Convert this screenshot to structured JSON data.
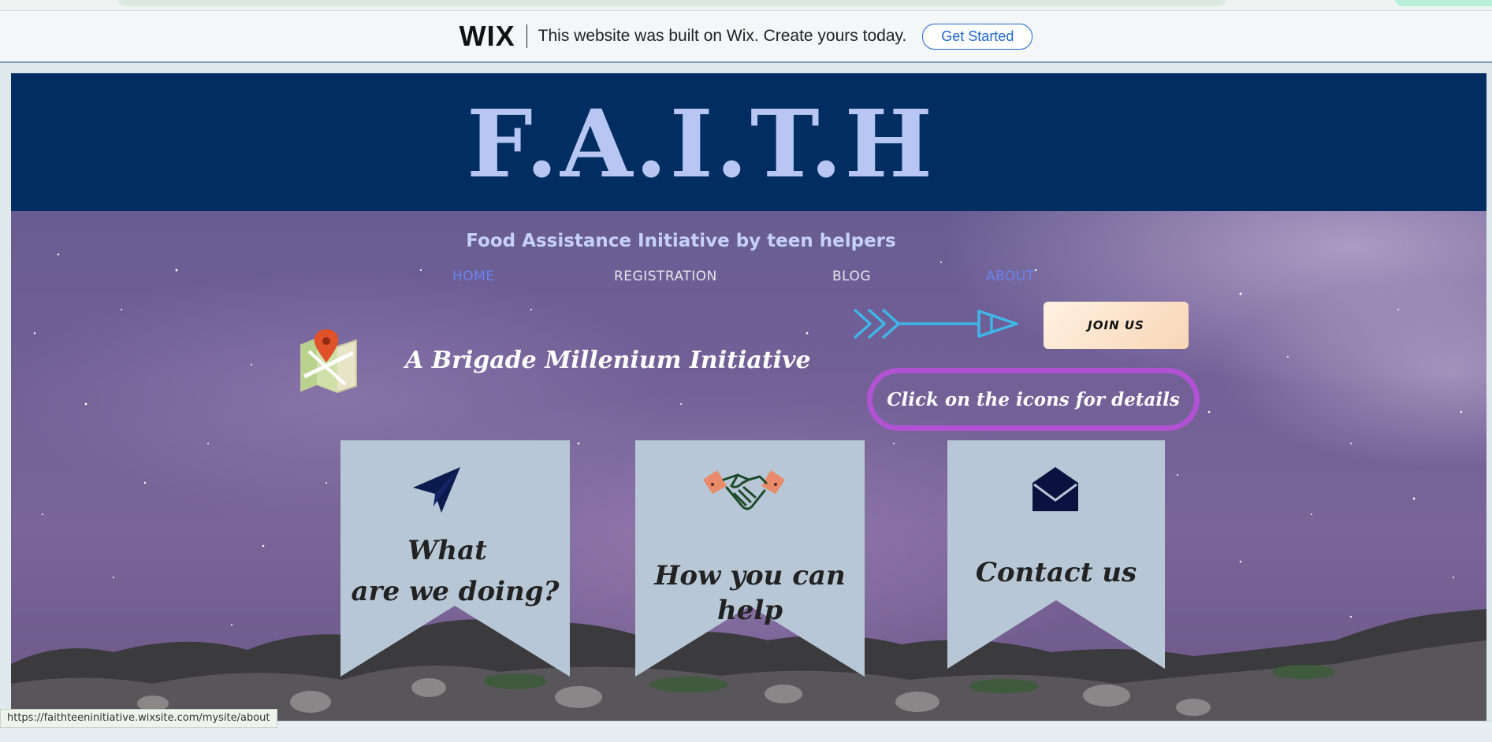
{
  "wix_banner": {
    "logo": "WIX",
    "message": "This website was built on Wix. Create yours today.",
    "cta_label": "Get Started"
  },
  "site": {
    "title": "F.A.I.T.H",
    "tagline": "Food Assistance Initiative by teen helpers",
    "nav": [
      {
        "label": "HOME",
        "color": "#6b83f0"
      },
      {
        "label": "REGISTRATION",
        "color": "#e4e4ec"
      },
      {
        "label": "BLOG",
        "color": "#e4e4ec"
      },
      {
        "label": "ABOUT",
        "color": "#6b83f0"
      }
    ],
    "subtitle": "A Brigade Millenium Initiative",
    "join_label": "JOIN US",
    "details_text": "Click on the icons for details",
    "cards": [
      {
        "label_line1": "What",
        "label_line2": "are we doing?",
        "icon": "paper-plane-icon"
      },
      {
        "label": "How you can help",
        "icon": "handshake-icon"
      },
      {
        "label": "Contact us",
        "icon": "envelope-icon"
      }
    ],
    "icons": {
      "map": "map-pin-icon",
      "arrow": "arrow-right-icon"
    }
  },
  "status_bar": {
    "url": "https://faithteeninitiative.wixsite.com/mysite/about"
  },
  "colors": {
    "header_band": "#002d62",
    "title": "#b7c6f2",
    "details_border": "#b152d3",
    "card_fill": "#b8c7d6",
    "wix_cta": "#1d67cd"
  }
}
